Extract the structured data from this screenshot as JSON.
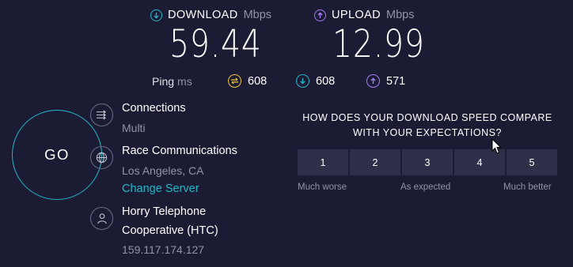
{
  "download": {
    "label": "DOWNLOAD",
    "unit": "Mbps",
    "value": "59.44",
    "icon": "download-arrow-icon",
    "color": "#20b7c8"
  },
  "upload": {
    "label": "UPLOAD",
    "unit": "Mbps",
    "value": "12.99",
    "icon": "upload-arrow-icon",
    "color": "#a77df5"
  },
  "ping": {
    "label": "Ping",
    "unit": "ms",
    "idle": {
      "value": "608",
      "icon": "idle-ping-icon",
      "color": "#f0c63e"
    },
    "download": {
      "value": "608",
      "icon": "download-ping-icon",
      "color": "#20b7c8"
    },
    "upload": {
      "value": "571",
      "icon": "upload-ping-icon",
      "color": "#a77df5"
    }
  },
  "go_button": {
    "label": "GO"
  },
  "connections": {
    "title": "Connections",
    "value": "Multi",
    "icon": "connections-icon"
  },
  "server": {
    "title": "Race Communications",
    "location": "Los Angeles, CA",
    "change_label": "Change Server",
    "icon": "globe-icon"
  },
  "provider": {
    "title_line1": "Horry Telephone",
    "title_line2": "Cooperative (HTC)",
    "ip": "159.117.174.127",
    "icon": "user-icon"
  },
  "survey": {
    "question_line1": "HOW DOES YOUR DOWNLOAD SPEED COMPARE",
    "question_line2": "WITH YOUR EXPECTATIONS?",
    "ratings": [
      "1",
      "2",
      "3",
      "4",
      "5"
    ],
    "scale_low": "Much worse",
    "scale_mid": "As expected",
    "scale_high": "Much better"
  }
}
